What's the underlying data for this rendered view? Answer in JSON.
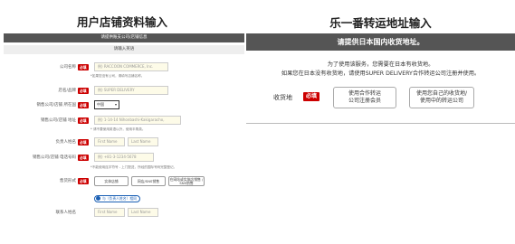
{
  "left": {
    "title": "用户店铺资料输入",
    "bar": "请提供账支公司/店铺信息",
    "subbar": "请输入英语",
    "fields": [
      {
        "label": "公司名称",
        "required": "必填",
        "placeholder": "例) RACCOON COMMERCE, Inc.",
        "note": "*如果您没有公司，请填写店铺名称。"
      },
      {
        "label": "店名/品牌",
        "required": "必填",
        "placeholder": "例) SUPER DELIVERY"
      },
      {
        "label": "销售公司/店铺 所在国",
        "required": "必填",
        "select": "中国"
      },
      {
        "label": "销售公司/店铺 地址",
        "required": "必填",
        "placeholder": "例) 1-14-14 Nihonbashi-Kakigaracho,",
        "note": "* 请不要使用英语以外，使用半角英。"
      },
      {
        "label": "负责人姓名",
        "required": "必填",
        "first": "First Name",
        "last": "Last Name"
      },
      {
        "label": "销售公司/店铺 电话号码",
        "required": "必填",
        "placeholder": "例) +81-3-1234-5678",
        "note": "*不能使用连字符号 - 上门配送，所经的国际号码完整登记。"
      },
      {
        "label": "售货形式",
        "required": "必填",
        "options": [
          "实体店铺",
          "网店/SNS销售",
          "在网站或实体店销售 / SNS销售"
        ]
      },
      {
        "label": "联系人姓名",
        "radio": "与（负责人姓名）相同",
        "first": "First Name",
        "last": "Last Name"
      }
    ]
  },
  "right": {
    "title": "乐一番转运地址输入",
    "bar": "请提供日本国内收货地址。",
    "line1": "为了使用该服务，您需要在日本有收货地。",
    "line2": "如果您在日本没有收货地，请使用SUPER DELIVERY合作转运公司注册并使用。",
    "delivery_label": "收货地",
    "required": "必填",
    "btn1": [
      "使用合作转运",
      "公司注册会员"
    ],
    "btn2": [
      "使用您自己的收货地/",
      "使用中的转运公司"
    ]
  }
}
